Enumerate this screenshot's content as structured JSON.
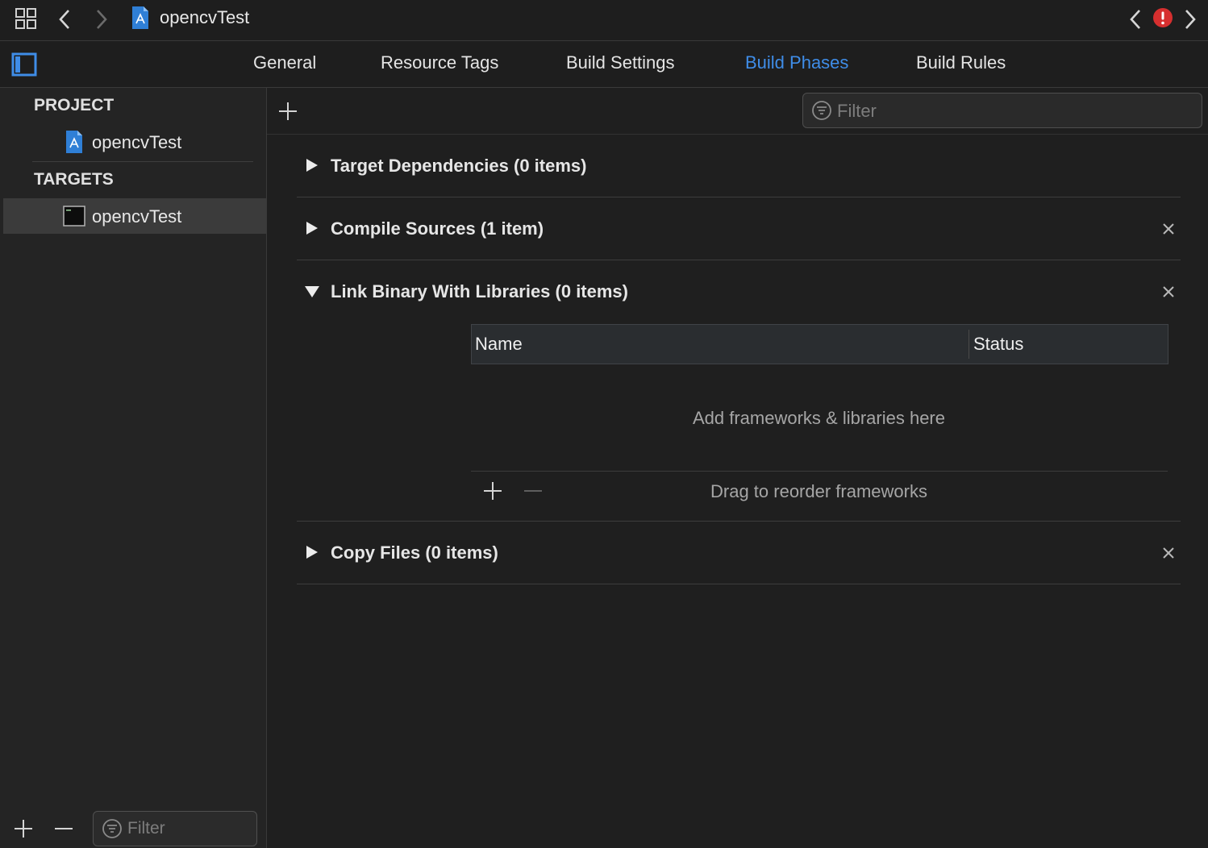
{
  "toolbar": {
    "file_title": "opencvTest"
  },
  "tabs": [
    {
      "label": "General",
      "active": false
    },
    {
      "label": "Resource Tags",
      "active": false
    },
    {
      "label": "Build Settings",
      "active": false
    },
    {
      "label": "Build Phases",
      "active": true
    },
    {
      "label": "Build Rules",
      "active": false
    }
  ],
  "sidebar": {
    "project_header": "PROJECT",
    "project_item": "opencvTest",
    "targets_header": "TARGETS",
    "target_item": "opencvTest",
    "filter_placeholder": "Filter"
  },
  "main": {
    "filter_placeholder": "Filter",
    "phases": [
      {
        "title": "Target Dependencies (0 items)",
        "expanded": false,
        "removable": false
      },
      {
        "title": "Compile Sources (1 item)",
        "expanded": false,
        "removable": true
      },
      {
        "title": "Link Binary With Libraries (0 items)",
        "expanded": true,
        "removable": true
      },
      {
        "title": "Copy Files (0 items)",
        "expanded": false,
        "removable": true
      }
    ],
    "link_table": {
      "col_name": "Name",
      "col_status": "Status",
      "empty_message": "Add frameworks & libraries here",
      "reorder_hint": "Drag to reorder frameworks"
    }
  },
  "colors": {
    "accent": "#3f8de8",
    "error": "#d62f2f",
    "background": "#1f1f1f"
  }
}
